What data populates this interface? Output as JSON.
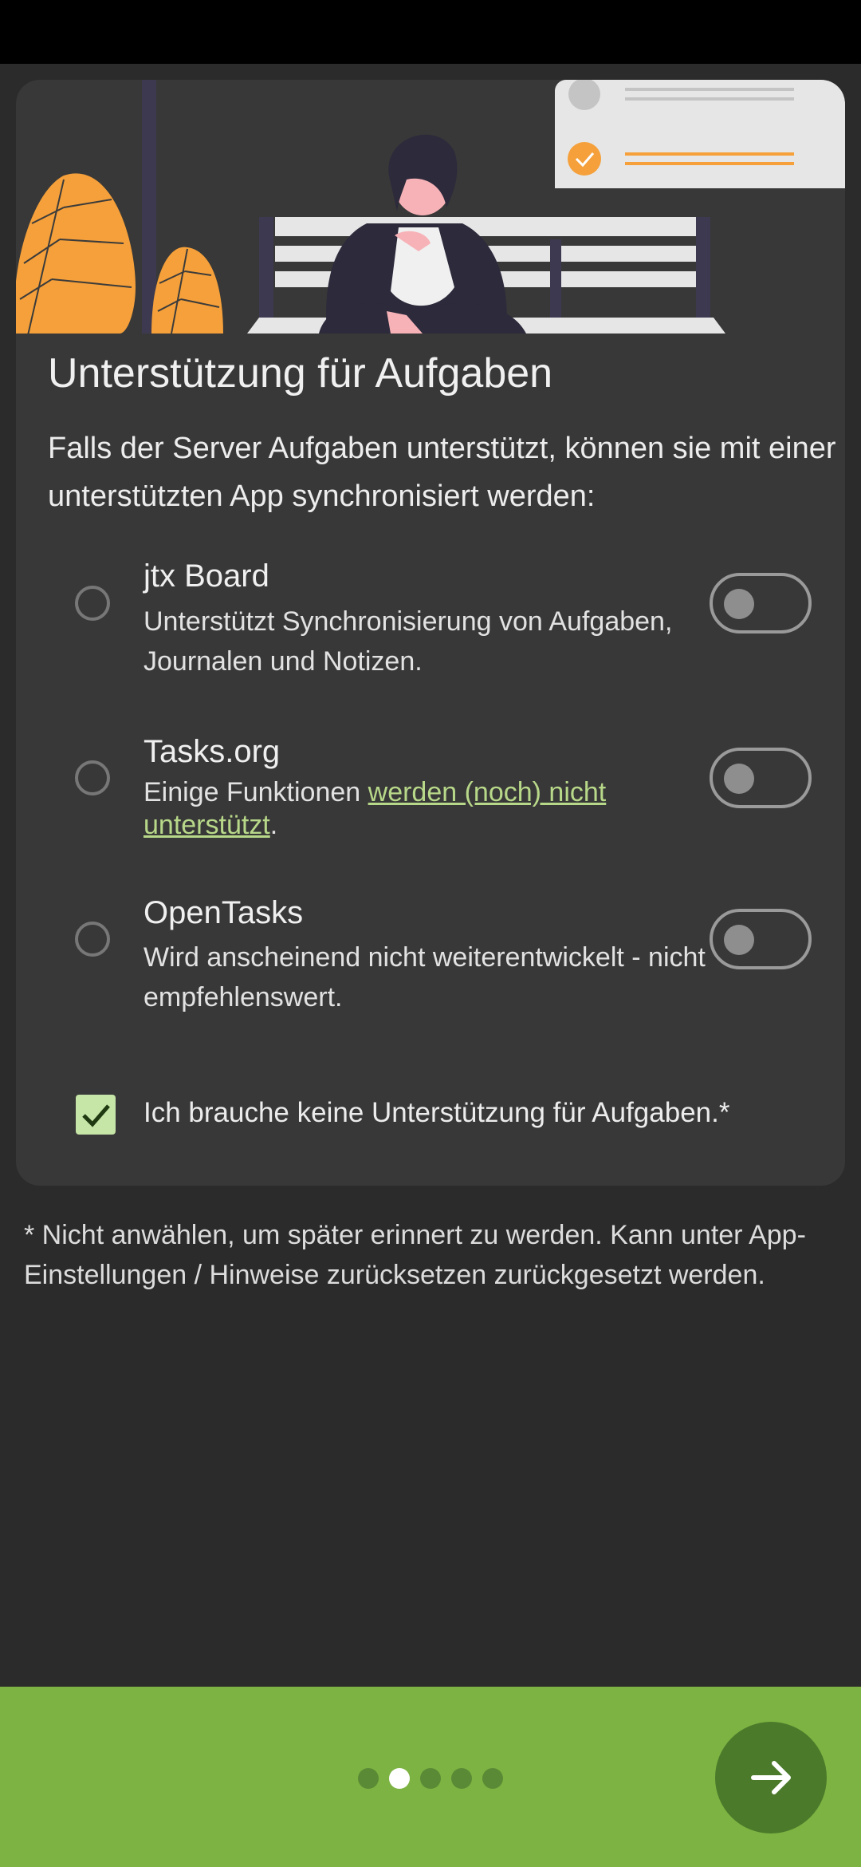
{
  "card": {
    "title": "Unterstützung für Aufgaben",
    "description": "Falls der Server Aufgaben unterstützt, können sie mit einer unterstützten App synchronisiert werden:",
    "options": [
      {
        "name": "jtx Board",
        "description": "Unterstützt Synchronisierung von Aufgaben, Journalen und Notizen.",
        "selected": false,
        "toggle_on": false
      },
      {
        "name": "Tasks.org",
        "description_prefix": "Einige Funktionen ",
        "description_link": "werden (noch) nicht unterstützt",
        "description_suffix": ".",
        "selected": false,
        "toggle_on": false
      },
      {
        "name": "OpenTasks",
        "description": "Wird anscheinend nicht weiterentwickelt - nicht empfehlenswert.",
        "selected": false,
        "toggle_on": false
      }
    ],
    "no_support_checkbox": {
      "label": "Ich brauche keine Unterstützung für Aufgaben.*",
      "checked": true
    }
  },
  "footnote": "* Nicht anwählen, um später erinnert zu werden. Kann unter App-Einstellungen / Hinweise zurücksetzen zurückgesetzt werden.",
  "pager": {
    "page_count": 5,
    "current_page": 2
  },
  "icons": {
    "next": "arrow-right-icon",
    "check": "checkmark-icon"
  },
  "colors": {
    "accent_green": "#7cb342",
    "link_green": "#b8d889",
    "illustration_orange": "#f5a03a",
    "card_background": "#383838",
    "page_background": "#2b2b2b"
  }
}
